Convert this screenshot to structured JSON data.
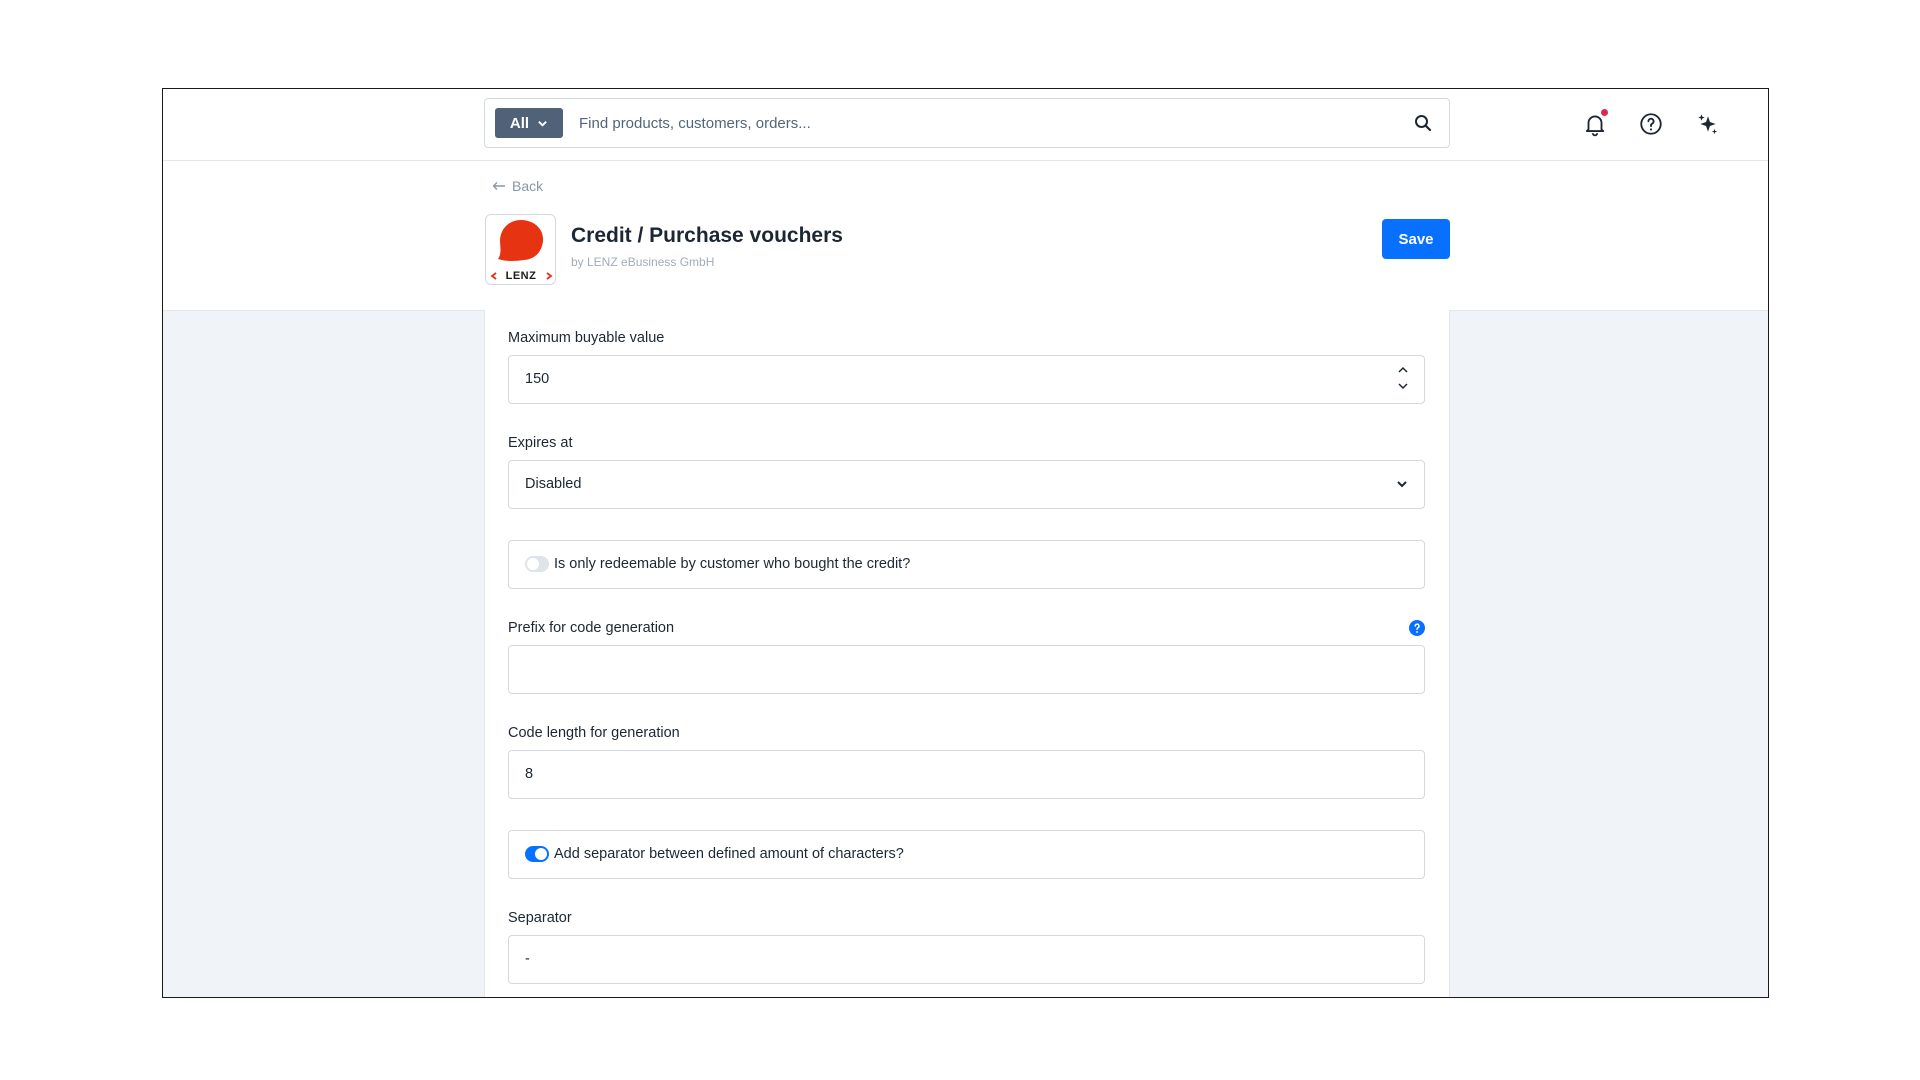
{
  "topbar": {
    "search_scope": "All",
    "search_placeholder": "Find products, customers, orders..."
  },
  "header": {
    "back_label": "Back",
    "logo_text": "LENZ",
    "title": "Credit / Purchase vouchers",
    "subtitle": "by LENZ eBusiness GmbH",
    "save_label": "Save"
  },
  "form": {
    "max_value_label": "Maximum buyable value",
    "max_value": "150",
    "expires_label": "Expires at",
    "expires_value": "Disabled",
    "redeemable_label": "Is only redeemable by customer who bought the credit?",
    "redeemable_on": false,
    "prefix_label": "Prefix for code generation",
    "prefix_value": "",
    "code_length_label": "Code length for generation",
    "code_length_value": "8",
    "separator_toggle_label": "Add separator between defined amount of characters?",
    "separator_toggle_on": true,
    "separator_label": "Separator",
    "separator_value": "-"
  },
  "colors": {
    "primary": "#0870ff",
    "scope_button": "#4f6278",
    "notification_dot": "#de294c",
    "logo_red": "#e63312"
  },
  "icons": [
    "chevron-down-icon",
    "search-icon",
    "bell-icon",
    "help-circle-icon",
    "sparkles-icon",
    "arrow-left-icon",
    "chevron-up-icon",
    "info-icon"
  ]
}
